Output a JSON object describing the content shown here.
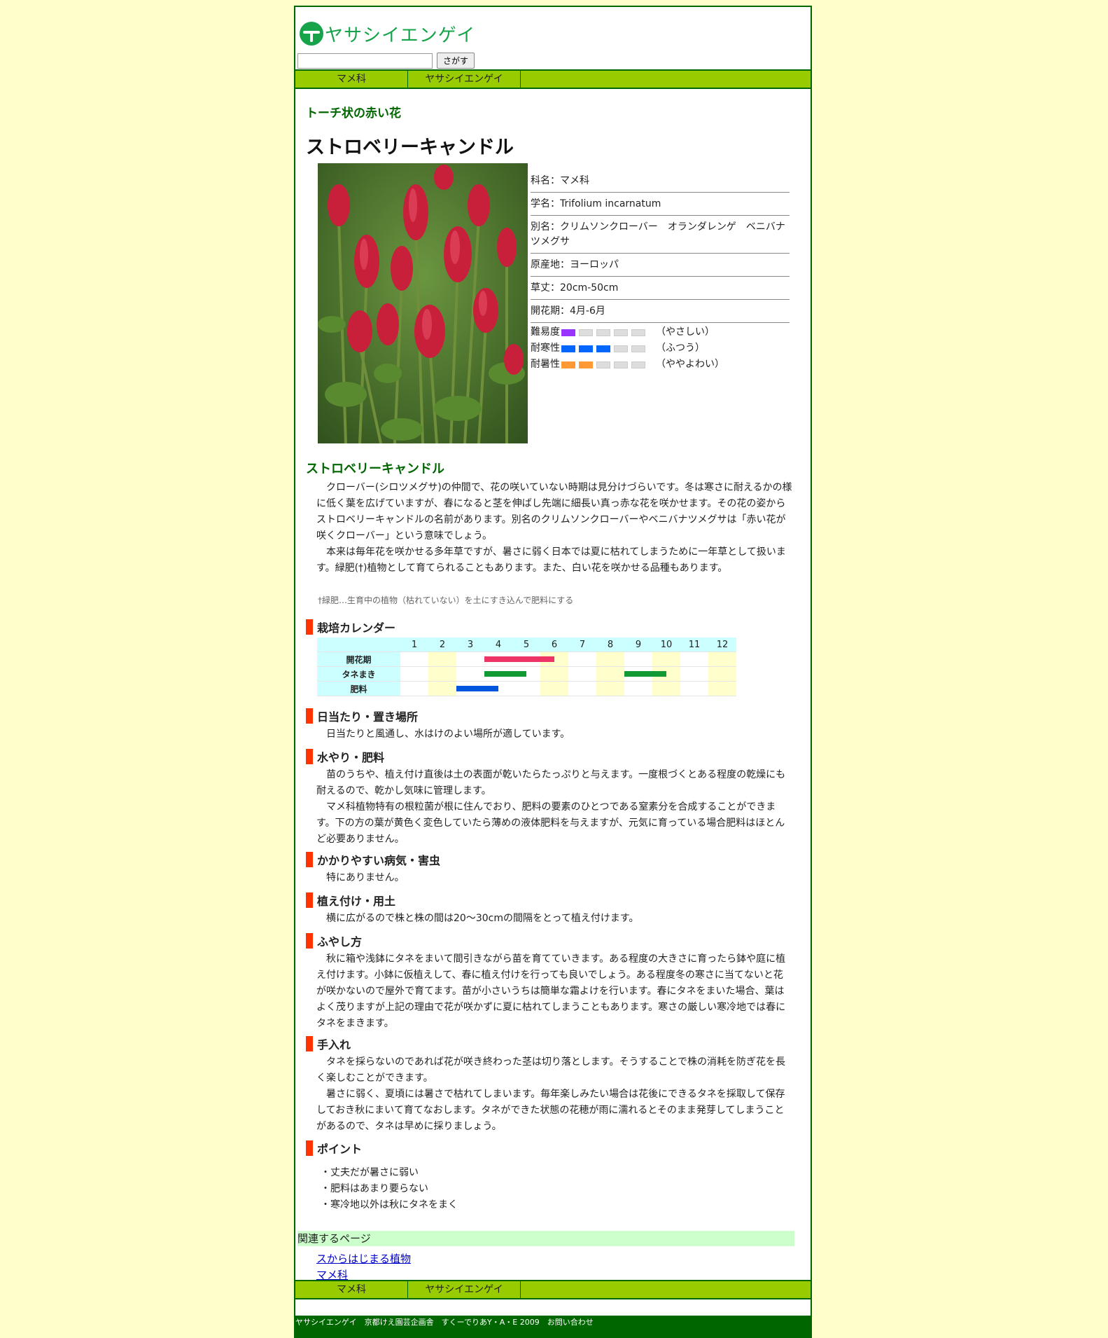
{
  "header": {
    "logo_text": "ヤサシイエンゲイ",
    "search_placeholder": "",
    "search_button": "さがす"
  },
  "nav": [
    "マメ科",
    "ヤサシイエンゲイ"
  ],
  "page": {
    "subtitle": "トーチ状の赤い花",
    "title": "ストロベリーキャンドル"
  },
  "info": {
    "family": "科名：マメ科",
    "scientific": "学名：Trifolium incarnatum",
    "aliases": "別名：クリムソンクローバー　オランダレンゲ　ベニバナツメグサ",
    "origin": "原産地：ヨーロッパ",
    "height": "草丈：20cm-50cm",
    "bloom": "開花期：4月-6月"
  },
  "ratings": [
    {
      "label": "難易度",
      "level": 1,
      "max": 5,
      "color": "#9933ff",
      "text": "（やさしい）"
    },
    {
      "label": "耐寒性",
      "level": 3,
      "max": 5,
      "color": "#0066ff",
      "text": "（ふつう）"
    },
    {
      "label": "耐暑性",
      "level": 2,
      "max": 5,
      "color": "#ff9933",
      "text": "（ややよわい）"
    }
  ],
  "intro": {
    "heading": "ストロベリーキャンドル",
    "p1": "　クローバー(シロツメグサ)の仲間で、花の咲いていない時期は見分けづらいです。冬は寒さに耐えるかの様に低く葉を広げていますが、春になると茎を伸ばし先端に細長い真っ赤な花を咲かせます。その花の姿からストロベリーキャンドルの名前があります。別名のクリムソンクローバーやベニバナツメグサは「赤い花が咲くクローバー」という意味でしょう。",
    "p2": "　本来は毎年花を咲かせる多年草ですが、暑さに弱く日本では夏に枯れてしまうために一年草として扱います。緑肥(†)植物として育てられることもあります。また、白い花を咲かせる品種もあります。",
    "note": "†緑肥…生育中の植物（枯れていない）を土にすき込んで肥料にする"
  },
  "calendar": {
    "heading": "栽培カレンダー",
    "months": [
      "1",
      "2",
      "3",
      "4",
      "5",
      "6",
      "7",
      "8",
      "9",
      "10",
      "11",
      "12"
    ],
    "rows": [
      {
        "label": "開花期",
        "color": "#ee3366",
        "ranges": [
          [
            4.0,
            6.5
          ]
        ]
      },
      {
        "label": "タネまき",
        "color": "#119933",
        "ranges": [
          [
            4.0,
            5.5
          ],
          [
            9.0,
            10.5
          ]
        ]
      },
      {
        "label": "肥料",
        "color": "#0055dd",
        "ranges": [
          [
            3.0,
            4.5
          ]
        ]
      }
    ]
  },
  "sections": {
    "sun": {
      "heading": "日当たり・置き場所",
      "text": "　日当たりと風通し、水はけのよい場所が適しています。"
    },
    "water": {
      "heading": "水やり・肥料",
      "p1": "　苗のうちや、植え付け直後は土の表面が乾いたらたっぷりと与えます。一度根づくとある程度の乾燥にも耐えるので、乾かし気味に管理します。",
      "p2": "　マメ科植物特有の根粒菌が根に住んでおり、肥料の要素のひとつである窒素分を合成することができます。下の方の葉が黄色く変色していたら薄めの液体肥料を与えますが、元気に育っている場合肥料はほとんど必要ありません。"
    },
    "pests": {
      "heading": "かかりやすい病気・害虫",
      "text": "　特にありません。"
    },
    "planting": {
      "heading": "植え付け・用土",
      "text": "　横に広がるので株と株の間は20～30cmの間隔をとって植え付けます。"
    },
    "propagation": {
      "heading": "ふやし方",
      "text": "　秋に箱や浅鉢にタネをまいて間引きながら苗を育てていきます。ある程度の大きさに育ったら鉢や庭に植え付けます。小鉢に仮植えして、春に植え付けを行っても良いでしょう。ある程度冬の寒さに当てないと花が咲かないので屋外で育てます。苗が小さいうちは簡単な霜よけを行います。春にタネをまいた場合、葉はよく茂りますが上記の理由で花が咲かずに夏に枯れてしまうこともあります。寒さの厳しい寒冷地では春にタネをまきます。"
    },
    "care": {
      "heading": "手入れ",
      "p1": "　タネを採らないのであれば花が咲き終わった茎は切り落とします。そうすることで株の消耗を防ぎ花を長く楽しむことができます。",
      "p2": "　暑さに弱く、夏頃には暑さで枯れてしまいます。毎年楽しみたい場合は花後にできるタネを採取して保存しておき秋にまいて育てなおします。タネができた状態の花穂が雨に濡れるとそのまま発芽してしまうことがあるので、タネは早めに採りましょう。"
    },
    "points": {
      "heading": "ポイント",
      "items": [
        "・丈夫だが暑さに弱い",
        "・肥料はあまり要らない",
        "・寒冷地以外は秋にタネをまく"
      ]
    }
  },
  "related": {
    "heading": "関連するページ",
    "links": [
      "スからはじまる植物",
      "マメ科"
    ]
  },
  "footer": {
    "text": "ヤサシイエンゲイ　京都けえ園芸企画舎　すくーでりあY・A・E 2009　お問い合わせ"
  }
}
